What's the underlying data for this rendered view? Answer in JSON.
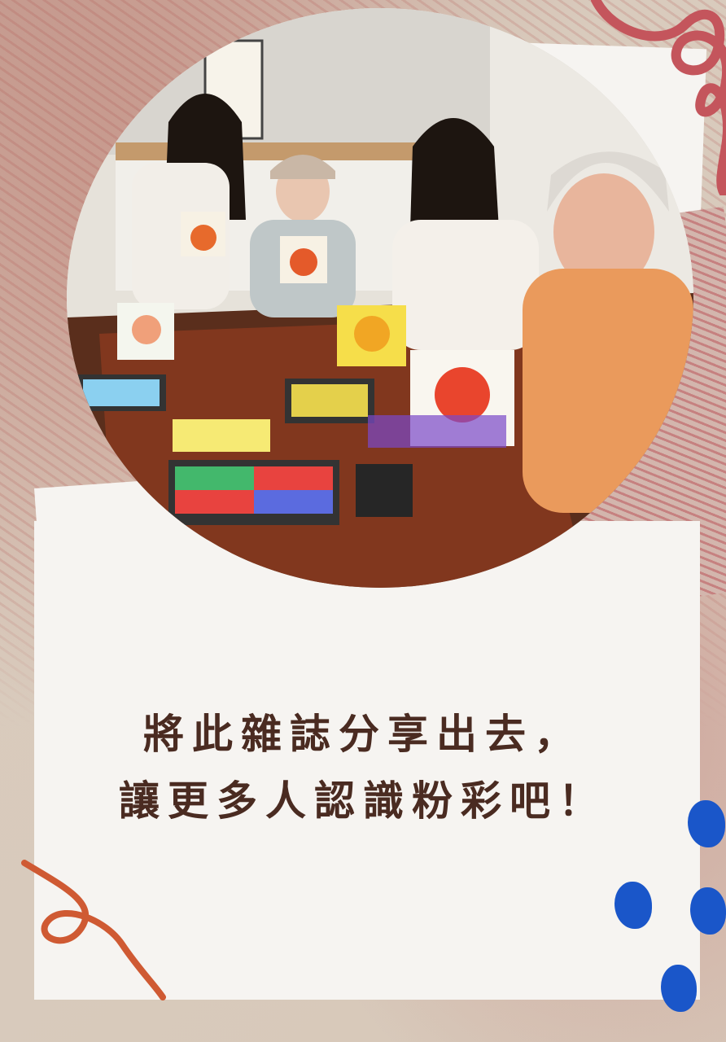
{
  "headline": {
    "line1": "將此雜誌分享出去，",
    "line2": "讓更多人認識粉彩吧！"
  },
  "colors": {
    "headline": "#4a2b21",
    "accent_blue": "#1a56c9",
    "accent_orange": "#cf5a33",
    "loops": "#c4555c",
    "paper": "#f6f4f1"
  },
  "photo": {
    "icon": "pastel-workshop-photo"
  }
}
